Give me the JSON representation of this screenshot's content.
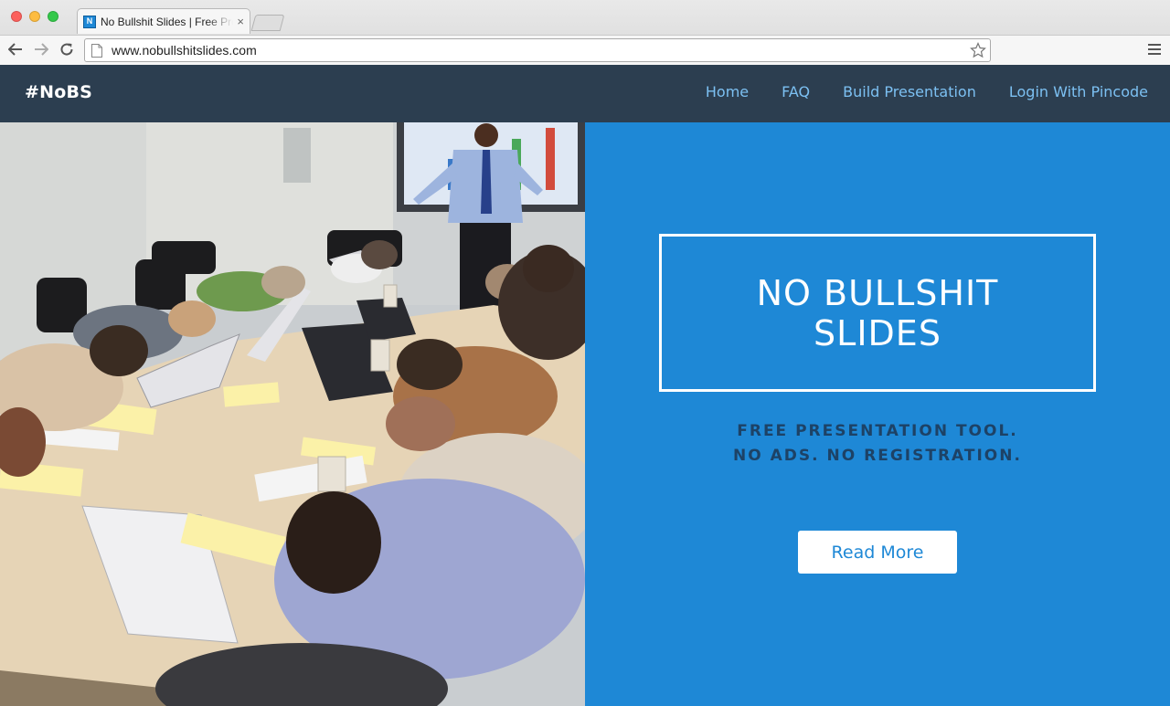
{
  "browser": {
    "tab_title": "No Bullshit Slides | Free Presentation Tool",
    "favicon_letter": "N",
    "tab_close": "×",
    "url": "www.nobullshitslides.com"
  },
  "site": {
    "brand": "#NoBS",
    "nav": [
      {
        "label": "Home"
      },
      {
        "label": "FAQ"
      },
      {
        "label": "Build Presentation"
      },
      {
        "label": "Login With Pincode"
      }
    ]
  },
  "hero": {
    "title_lines": [
      "NO BULLSHIT",
      "SLIDES"
    ],
    "tagline_lines": [
      "FREE PRESENTATION TOOL.",
      "NO ADS. NO REGISTRATION."
    ],
    "cta_label": "Read More"
  },
  "colors": {
    "nav_bg": "#2c3e50",
    "nav_link": "#7cc0f2",
    "accent_blue": "#1e88d6",
    "tagline": "#1d4266"
  }
}
